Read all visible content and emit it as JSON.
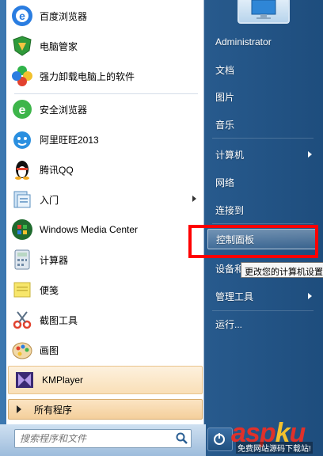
{
  "left_programs": [
    {
      "label": "百度浏览器",
      "icon": "baidu-browser-icon"
    },
    {
      "label": "电脑管家",
      "icon": "pc-manager-shield-icon"
    },
    {
      "label": "强力卸载电脑上的软件",
      "icon": "uninstall-flower-icon"
    },
    {
      "label": "安全浏览器",
      "icon": "safe-browser-icon"
    },
    {
      "label": "阿里旺旺2013",
      "icon": "aliwangwang-icon"
    },
    {
      "label": "腾讯QQ",
      "icon": "qq-penguin-icon"
    },
    {
      "label": "入门",
      "icon": "getting-started-icon"
    },
    {
      "label": "Windows Media Center",
      "icon": "windows-media-center-icon"
    },
    {
      "label": "计算器",
      "icon": "calculator-icon"
    },
    {
      "label": "便笺",
      "icon": "sticky-notes-icon"
    },
    {
      "label": "截图工具",
      "icon": "snipping-tool-icon"
    },
    {
      "label": "画图",
      "icon": "paint-icon"
    },
    {
      "label": "KMPlayer",
      "icon": "kmplayer-icon"
    }
  ],
  "all_programs_label": "所有程序",
  "search": {
    "placeholder": "搜索程序和文件"
  },
  "right_items": {
    "user": "Administrator",
    "documents": "文档",
    "pictures": "图片",
    "music": "音乐",
    "computer": "计算机",
    "network": "网络",
    "connect_to": "连接到",
    "control_panel": "控制面板",
    "devices": "设备和",
    "admin_tools": "管理工具",
    "run": "运行..."
  },
  "tooltip": "更改您的计算机设置",
  "watermark": {
    "logo_a": "asp",
    "logo_dot": "k",
    "logo_b": "u",
    "sub": "免费网站源码下载站!"
  },
  "colors": {
    "accent_red": "#ff0000",
    "highlight": "#f9dfb7"
  }
}
